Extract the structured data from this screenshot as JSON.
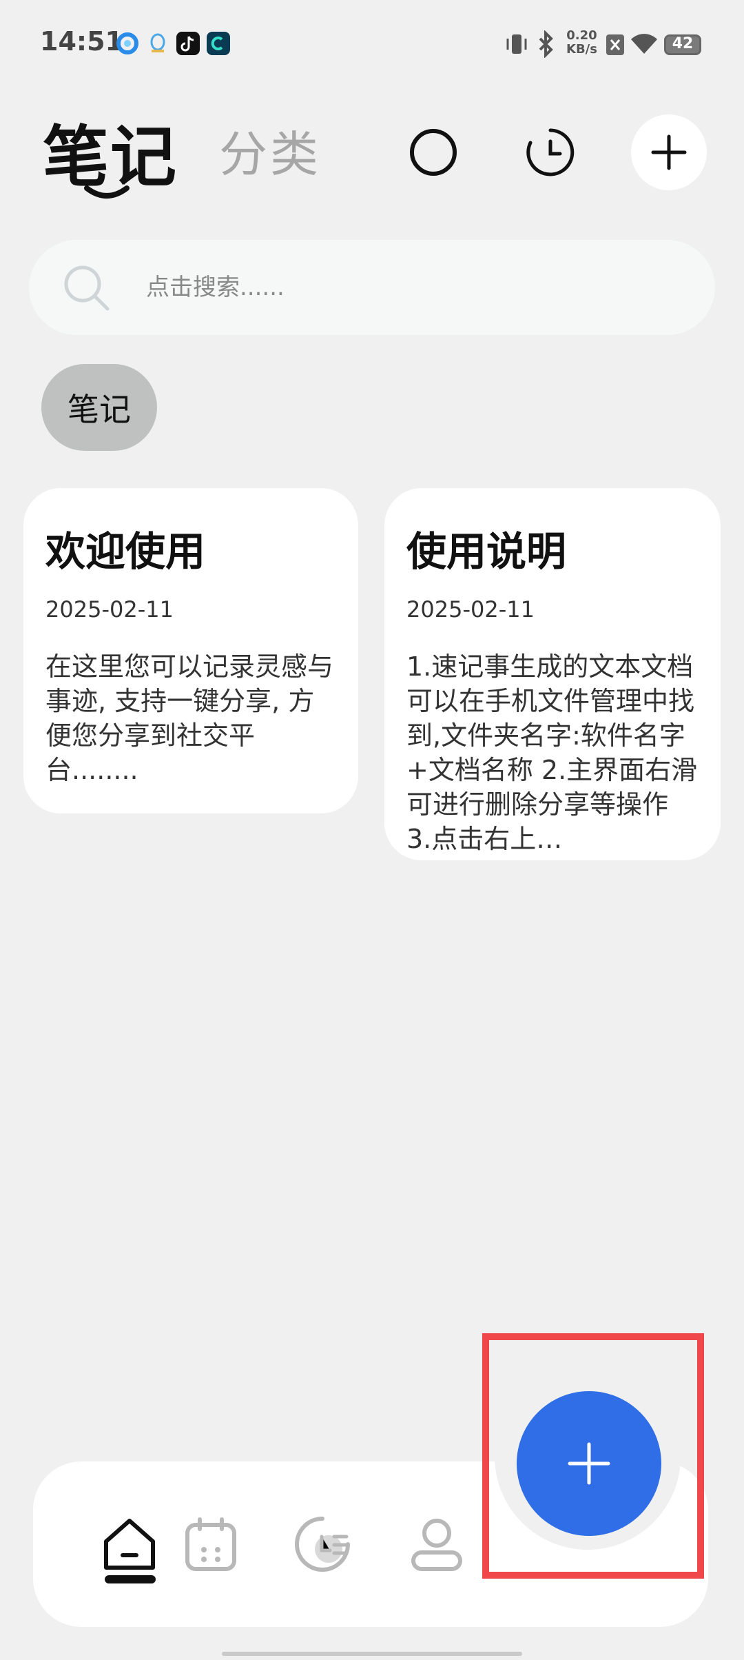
{
  "status_bar": {
    "time": "14:51",
    "net_speed_value": "0.20",
    "net_speed_unit": "KB/s",
    "battery": "42"
  },
  "header": {
    "tab_notes": "笔记",
    "tab_category": "分类"
  },
  "search": {
    "placeholder": "点击搜索......"
  },
  "filter_chip": "笔记",
  "notes": [
    {
      "title": "欢迎使用",
      "date": "2025-02-11",
      "body": "在这里您可以记录灵感与事迹, 支持一键分享, 方便您分享到社交平台........"
    },
    {
      "title": "使用说明",
      "date": "2025-02-11",
      "body": "1.速记事生成的文本文档可以在手机文件管理中找到,文件夹名字:软件名字+文档名称 2.主界面右滑可进行删除分享等操作 3.点击右上…"
    }
  ],
  "colors": {
    "background": "#eff0ef",
    "fab": "#2f6ee6",
    "highlight": "#f0474a",
    "tab_inactive": "#a6a6a6"
  },
  "icons": {
    "header": [
      "circle-icon",
      "clock-icon",
      "plus-icon"
    ],
    "nav": [
      "home-icon",
      "calendar-icon",
      "history-icon",
      "profile-icon"
    ],
    "fab": "plus-icon"
  }
}
